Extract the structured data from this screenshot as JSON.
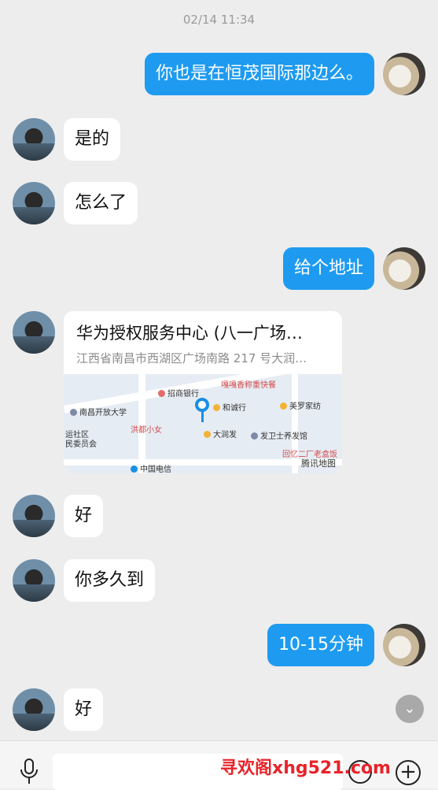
{
  "timestamp": "02/14 11:34",
  "messages": [
    {
      "text": "你也是在恒茂国际那边么。"
    },
    {
      "text": "是的"
    },
    {
      "text": "怎么了"
    },
    {
      "text": "给个地址"
    },
    {
      "text": "好"
    },
    {
      "text": "你多久到"
    },
    {
      "text": "10-15分钟"
    },
    {
      "text": "好"
    }
  ],
  "location_card": {
    "title": "华为授权服务中心 (八一广场…",
    "address": "江西省南昌市西湖区广场南路 217 号大润…",
    "map_logo": "腾讯地图",
    "pois": [
      "招商银行",
      "嘎嘎香称重快餐",
      "和诚行",
      "美罗家纺",
      "南昌开放大学",
      "洪都小女",
      "大润发",
      "发卫士养发馆",
      "运社区",
      "民委员会",
      "回忆二厂老盒饭",
      "中国电信"
    ]
  },
  "watermark": "寻欢阁xhg521.com",
  "icons": [
    "voice-icon",
    "emoji-icon",
    "plus-icon",
    "scroll-down-icon"
  ]
}
